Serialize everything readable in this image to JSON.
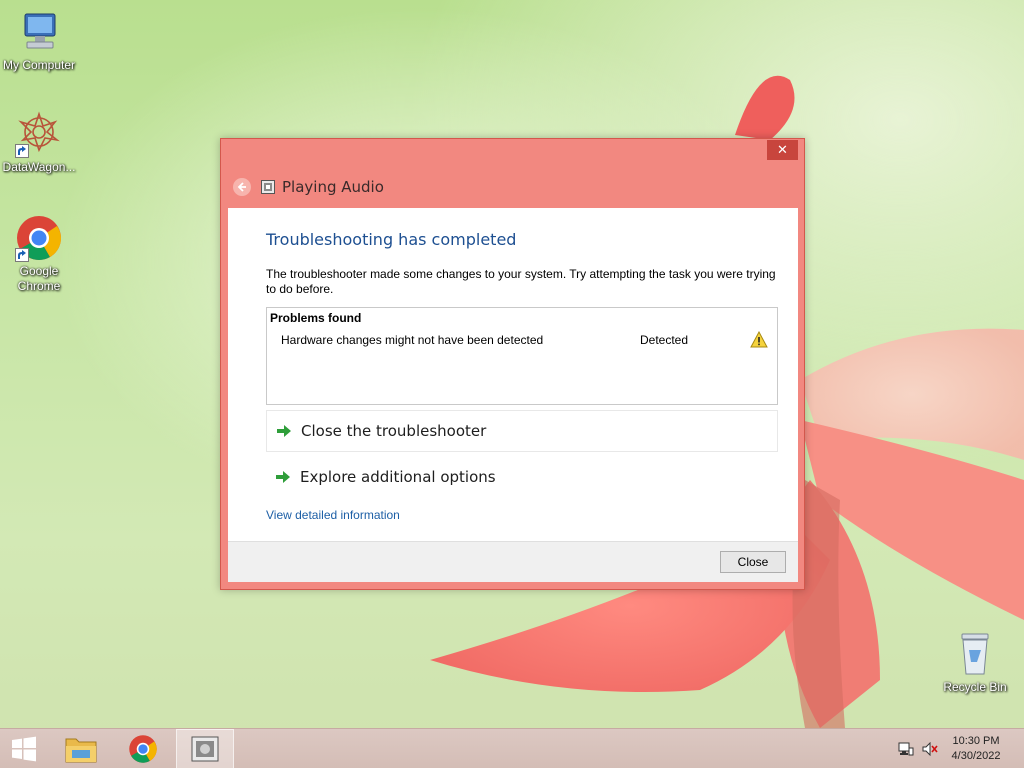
{
  "desktop": {
    "icons": [
      {
        "label": "My Computer"
      },
      {
        "label": "DataWagon..."
      },
      {
        "label": "Google Chrome"
      },
      {
        "label": "Recycle Bin"
      }
    ]
  },
  "dialog": {
    "title": "Playing Audio",
    "close_glyph": "✕",
    "heading": "Troubleshooting has completed",
    "description": "The troubleshooter made some changes to your system. Try attempting the task you were trying to do before.",
    "problems": {
      "header": "Problems found",
      "rows": [
        {
          "name": "Hardware changes might not have been detected",
          "status": "Detected",
          "icon": "warning-icon"
        }
      ]
    },
    "actions": {
      "close_troubleshooter": "Close the troubleshooter",
      "explore": "Explore additional options"
    },
    "link": "View detailed information",
    "close_button": "Close"
  },
  "taskbar": {
    "time": "10:30 PM",
    "date": "4/30/2022"
  },
  "colors": {
    "dialog_frame": "#f28880",
    "heading": "#1d4f91",
    "link": "#1d5fa6"
  }
}
